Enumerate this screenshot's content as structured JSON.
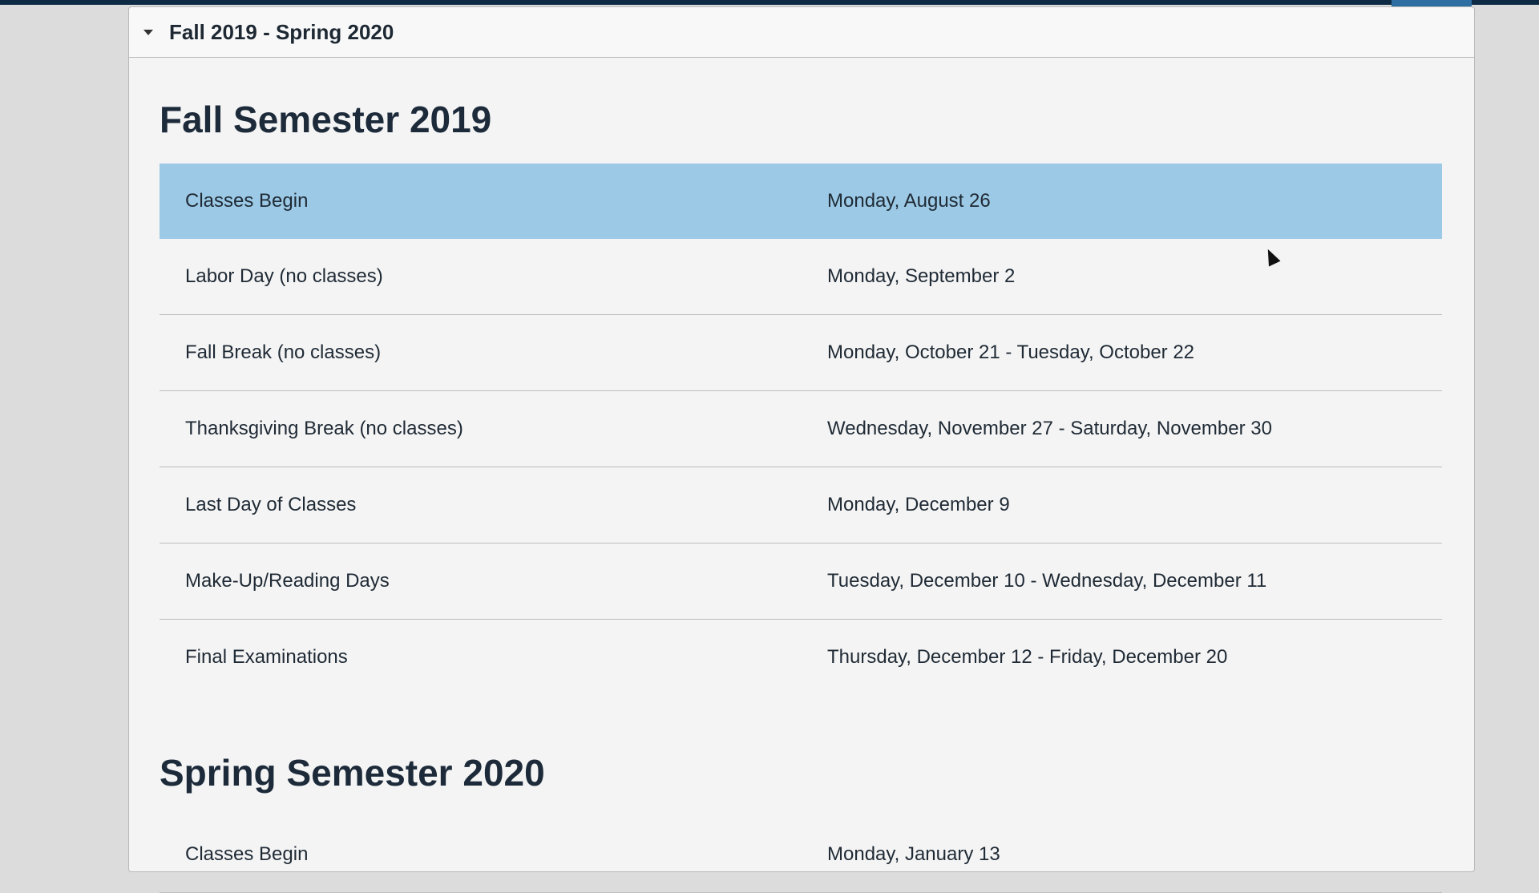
{
  "accordion": {
    "title": "Fall 2019 - Spring 2020"
  },
  "fall": {
    "heading": "Fall Semester 2019",
    "rows": [
      {
        "event": "Classes Begin",
        "date": "Monday, August 26"
      },
      {
        "event": "Labor Day (no classes)",
        "date": "Monday, September 2"
      },
      {
        "event": "Fall Break (no classes)",
        "date": "Monday, October 21 - Tuesday, October 22"
      },
      {
        "event": "Thanksgiving Break (no classes)",
        "date": "Wednesday, November 27 - Saturday, November 30"
      },
      {
        "event": "Last Day of Classes",
        "date": "Monday, December 9"
      },
      {
        "event": "Make-Up/Reading Days",
        "date": "Tuesday, December 10 - Wednesday, December 11"
      },
      {
        "event": "Final Examinations",
        "date": "Thursday, December 12 - Friday, December 20"
      }
    ]
  },
  "spring": {
    "heading": "Spring Semester 2020",
    "rows": [
      {
        "event": "Classes Begin",
        "date": "Monday, January 13"
      }
    ]
  },
  "colors": {
    "highlight_row": "#9ccae6",
    "top_bar": "#0f2a44"
  },
  "icons": {
    "caret": "caret-down-icon",
    "pointer": "mouse-pointer-icon"
  }
}
